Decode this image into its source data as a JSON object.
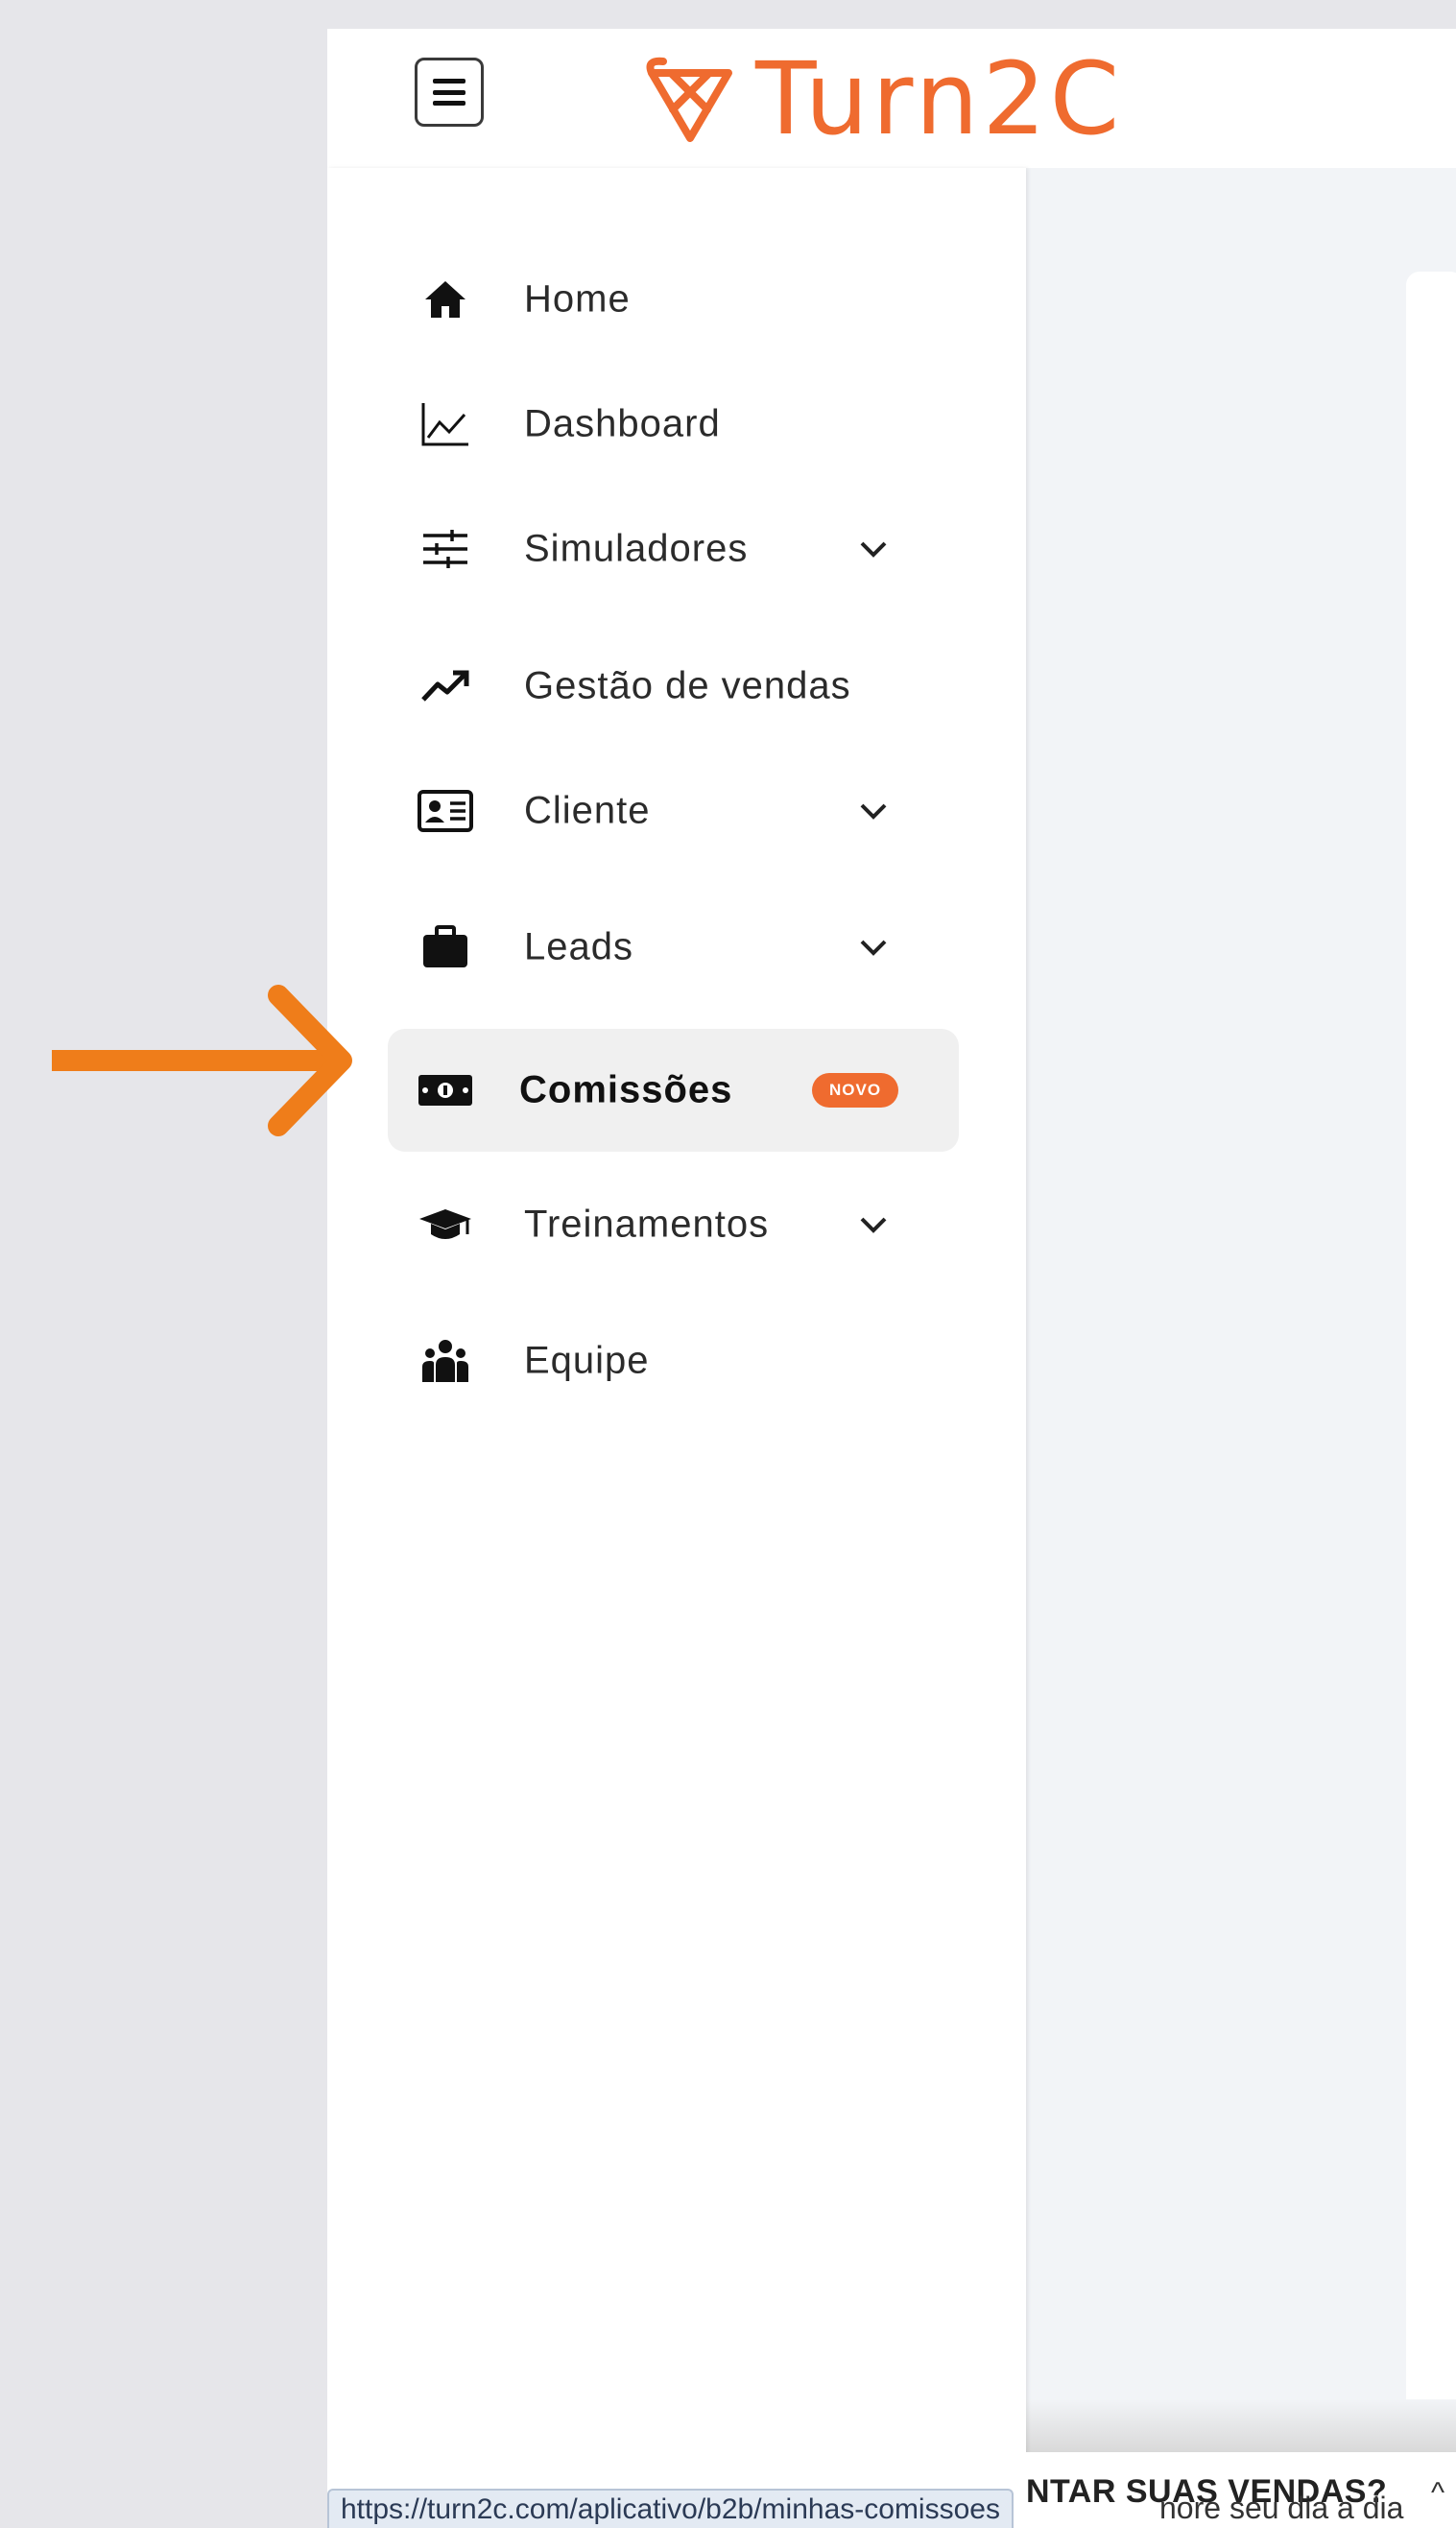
{
  "brand": {
    "name": "Turn2C",
    "color": "#ef6b2f"
  },
  "sidebar": {
    "items": [
      {
        "label": "Home",
        "icon": "home-icon",
        "has_submenu": false
      },
      {
        "label": "Dashboard",
        "icon": "line-chart-icon",
        "has_submenu": false
      },
      {
        "label": "Simuladores",
        "icon": "sliders-icon",
        "has_submenu": true
      },
      {
        "label": "Gestão de vendas",
        "icon": "trending-up-icon",
        "has_submenu": false
      },
      {
        "label": "Cliente",
        "icon": "id-card-icon",
        "has_submenu": true
      },
      {
        "label": "Leads",
        "icon": "briefcase-icon",
        "has_submenu": true
      },
      {
        "label": "Comissões",
        "icon": "money-bill-icon",
        "has_submenu": false,
        "active": true,
        "badge": "NOVO"
      },
      {
        "label": "Treinamentos",
        "icon": "graduation-cap-icon",
        "has_submenu": true
      },
      {
        "label": "Equipe",
        "icon": "team-icon",
        "has_submenu": false
      }
    ]
  },
  "annotation": {
    "arrow_color": "#ef7d1a",
    "points_to": "Comissões"
  },
  "banner": {
    "title": "NTAR SUAS VENDAS?",
    "subtitle": "nore seu dia a dia"
  },
  "status_bar": {
    "url": "https://turn2c.com/aplicativo/b2b/minhas-comissoes"
  }
}
